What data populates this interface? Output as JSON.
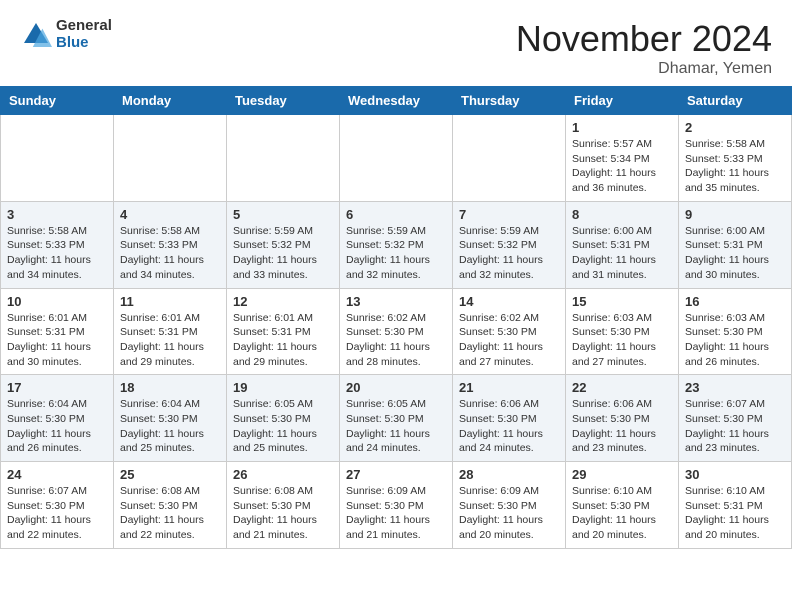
{
  "header": {
    "logo_general": "General",
    "logo_blue": "Blue",
    "month_title": "November 2024",
    "location": "Dhamar, Yemen"
  },
  "weekdays": [
    "Sunday",
    "Monday",
    "Tuesday",
    "Wednesday",
    "Thursday",
    "Friday",
    "Saturday"
  ],
  "weeks": [
    [
      {
        "day": "",
        "info": ""
      },
      {
        "day": "",
        "info": ""
      },
      {
        "day": "",
        "info": ""
      },
      {
        "day": "",
        "info": ""
      },
      {
        "day": "",
        "info": ""
      },
      {
        "day": "1",
        "info": "Sunrise: 5:57 AM\nSunset: 5:34 PM\nDaylight: 11 hours and 36 minutes."
      },
      {
        "day": "2",
        "info": "Sunrise: 5:58 AM\nSunset: 5:33 PM\nDaylight: 11 hours and 35 minutes."
      }
    ],
    [
      {
        "day": "3",
        "info": "Sunrise: 5:58 AM\nSunset: 5:33 PM\nDaylight: 11 hours and 34 minutes."
      },
      {
        "day": "4",
        "info": "Sunrise: 5:58 AM\nSunset: 5:33 PM\nDaylight: 11 hours and 34 minutes."
      },
      {
        "day": "5",
        "info": "Sunrise: 5:59 AM\nSunset: 5:32 PM\nDaylight: 11 hours and 33 minutes."
      },
      {
        "day": "6",
        "info": "Sunrise: 5:59 AM\nSunset: 5:32 PM\nDaylight: 11 hours and 32 minutes."
      },
      {
        "day": "7",
        "info": "Sunrise: 5:59 AM\nSunset: 5:32 PM\nDaylight: 11 hours and 32 minutes."
      },
      {
        "day": "8",
        "info": "Sunrise: 6:00 AM\nSunset: 5:31 PM\nDaylight: 11 hours and 31 minutes."
      },
      {
        "day": "9",
        "info": "Sunrise: 6:00 AM\nSunset: 5:31 PM\nDaylight: 11 hours and 30 minutes."
      }
    ],
    [
      {
        "day": "10",
        "info": "Sunrise: 6:01 AM\nSunset: 5:31 PM\nDaylight: 11 hours and 30 minutes."
      },
      {
        "day": "11",
        "info": "Sunrise: 6:01 AM\nSunset: 5:31 PM\nDaylight: 11 hours and 29 minutes."
      },
      {
        "day": "12",
        "info": "Sunrise: 6:01 AM\nSunset: 5:31 PM\nDaylight: 11 hours and 29 minutes."
      },
      {
        "day": "13",
        "info": "Sunrise: 6:02 AM\nSunset: 5:30 PM\nDaylight: 11 hours and 28 minutes."
      },
      {
        "day": "14",
        "info": "Sunrise: 6:02 AM\nSunset: 5:30 PM\nDaylight: 11 hours and 27 minutes."
      },
      {
        "day": "15",
        "info": "Sunrise: 6:03 AM\nSunset: 5:30 PM\nDaylight: 11 hours and 27 minutes."
      },
      {
        "day": "16",
        "info": "Sunrise: 6:03 AM\nSunset: 5:30 PM\nDaylight: 11 hours and 26 minutes."
      }
    ],
    [
      {
        "day": "17",
        "info": "Sunrise: 6:04 AM\nSunset: 5:30 PM\nDaylight: 11 hours and 26 minutes."
      },
      {
        "day": "18",
        "info": "Sunrise: 6:04 AM\nSunset: 5:30 PM\nDaylight: 11 hours and 25 minutes."
      },
      {
        "day": "19",
        "info": "Sunrise: 6:05 AM\nSunset: 5:30 PM\nDaylight: 11 hours and 25 minutes."
      },
      {
        "day": "20",
        "info": "Sunrise: 6:05 AM\nSunset: 5:30 PM\nDaylight: 11 hours and 24 minutes."
      },
      {
        "day": "21",
        "info": "Sunrise: 6:06 AM\nSunset: 5:30 PM\nDaylight: 11 hours and 24 minutes."
      },
      {
        "day": "22",
        "info": "Sunrise: 6:06 AM\nSunset: 5:30 PM\nDaylight: 11 hours and 23 minutes."
      },
      {
        "day": "23",
        "info": "Sunrise: 6:07 AM\nSunset: 5:30 PM\nDaylight: 11 hours and 23 minutes."
      }
    ],
    [
      {
        "day": "24",
        "info": "Sunrise: 6:07 AM\nSunset: 5:30 PM\nDaylight: 11 hours and 22 minutes."
      },
      {
        "day": "25",
        "info": "Sunrise: 6:08 AM\nSunset: 5:30 PM\nDaylight: 11 hours and 22 minutes."
      },
      {
        "day": "26",
        "info": "Sunrise: 6:08 AM\nSunset: 5:30 PM\nDaylight: 11 hours and 21 minutes."
      },
      {
        "day": "27",
        "info": "Sunrise: 6:09 AM\nSunset: 5:30 PM\nDaylight: 11 hours and 21 minutes."
      },
      {
        "day": "28",
        "info": "Sunrise: 6:09 AM\nSunset: 5:30 PM\nDaylight: 11 hours and 20 minutes."
      },
      {
        "day": "29",
        "info": "Sunrise: 6:10 AM\nSunset: 5:30 PM\nDaylight: 11 hours and 20 minutes."
      },
      {
        "day": "30",
        "info": "Sunrise: 6:10 AM\nSunset: 5:31 PM\nDaylight: 11 hours and 20 minutes."
      }
    ]
  ]
}
